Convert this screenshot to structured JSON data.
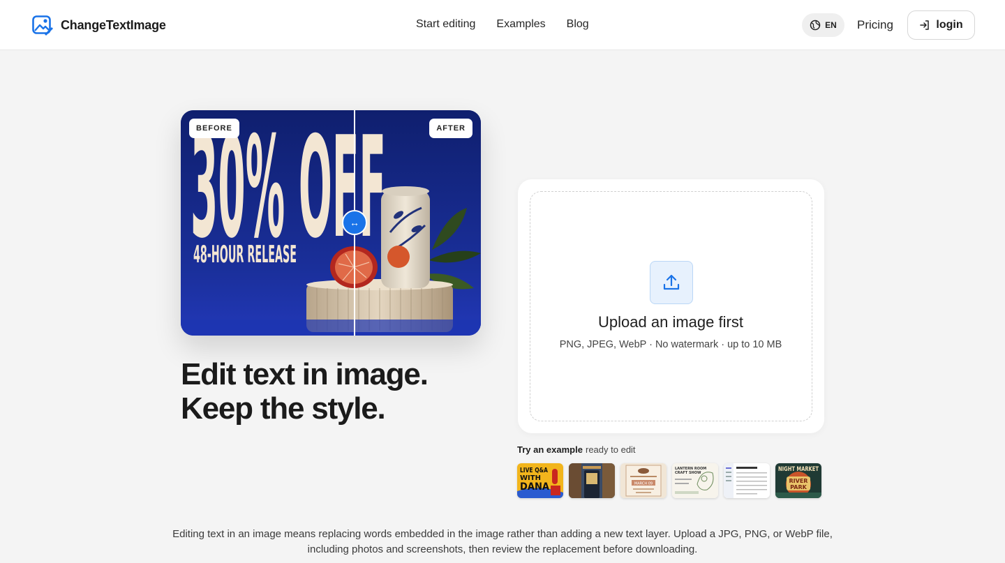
{
  "header": {
    "brand_name": "ChangeTextImage",
    "nav": [
      "Start editing",
      "Examples",
      "Blog"
    ],
    "lang": "EN",
    "pricing": "Pricing",
    "login": "login"
  },
  "hero": {
    "before_label": "BEFORE",
    "after_label": "AFTER",
    "handle_glyph": "↔",
    "poster_big_text": "30% OFF",
    "poster_small_text": "48-HOUR RELEASE",
    "headline_line1": "Edit text in image.",
    "headline_line2": "Keep the style.",
    "slider_position": 0.58
  },
  "upload": {
    "title": "Upload an image first",
    "subtitle": "PNG, JPEG, WebP · No watermark · up to 10 MB"
  },
  "examples": {
    "label": "Try an example",
    "sublabel": "ready to edit",
    "thumbs": [
      {
        "name": "live-qa-thumb",
        "text": [
          "LIVE Q&A",
          "WITH",
          "DANA"
        ]
      },
      {
        "name": "storefront-thumb",
        "text": []
      },
      {
        "name": "menu-card-thumb",
        "text": [
          "MARCH 09"
        ]
      },
      {
        "name": "craft-show-thumb",
        "text": [
          "LANTERN ROOM",
          "CRAFT SHOW"
        ]
      },
      {
        "name": "spreadsheet-thumb",
        "text": []
      },
      {
        "name": "night-market-thumb",
        "text": [
          "NIGHT MARKET",
          "RIVER",
          "PARK"
        ]
      }
    ]
  },
  "description": "Editing text in an image means replacing words embedded in the image rather than adding a new text layer. Upload a JPG, PNG, or WebP file, including photos and screenshots, then review the replacement before downloading.",
  "colors": {
    "accent": "#1a73e8",
    "poster_bg": "#16288a",
    "poster_text": "#f3e6d3",
    "page_bg": "#f4f4f4"
  }
}
